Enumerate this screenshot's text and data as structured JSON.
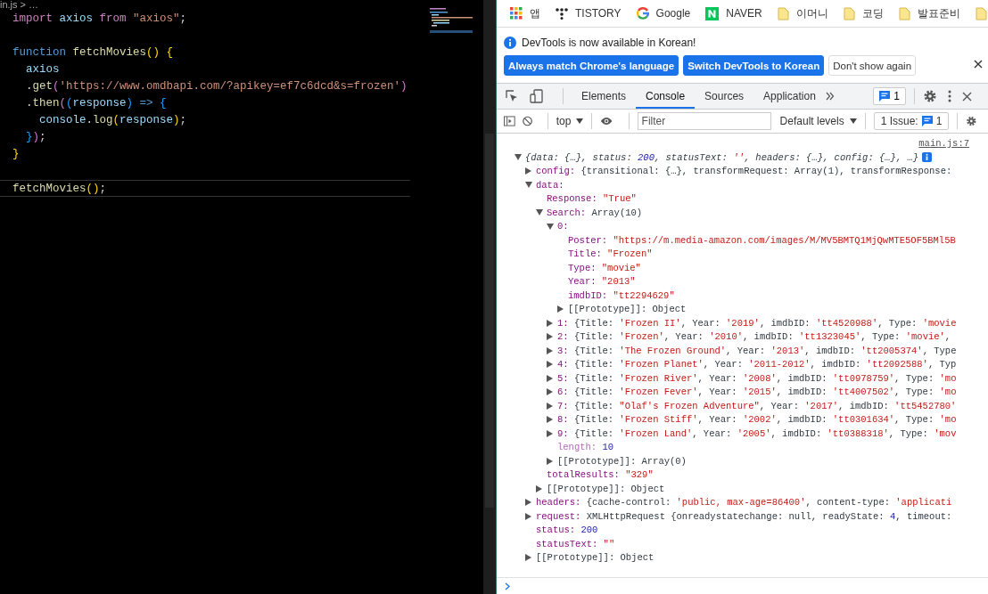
{
  "editor": {
    "breadcrumb": "in.js > …",
    "lines": [
      {
        "current": false,
        "tokens": [
          {
            "kind": "keyword",
            "text": "import"
          },
          {
            "kind": "variable",
            "text": " axios"
          },
          {
            "kind": "keyword",
            "text": " from"
          },
          {
            "kind": "string",
            "text": " \"axios\""
          },
          {
            "kind": "punctuation",
            "text": ";"
          }
        ]
      },
      {
        "current": false
      },
      {
        "current": false,
        "tokens": [
          {
            "kind": "storage",
            "text": "function"
          },
          {
            "kind": "function",
            "text": " fetchMovies"
          },
          {
            "kind": "bracket",
            "text": "()"
          },
          {
            "kind": "bracket",
            "text": " {"
          }
        ]
      },
      {
        "current": false,
        "tokens": [
          {
            "kind": "variable",
            "text": "  axios"
          }
        ]
      },
      {
        "current": false,
        "tokens": [
          {
            "kind": "punctuation",
            "text": "  ."
          },
          {
            "kind": "function",
            "text": "get"
          },
          {
            "kind": "bracket2",
            "text": "("
          },
          {
            "kind": "string",
            "text": "'https://www.omdbapi.com/?apikey=ef7c6dcd&s=frozen'"
          },
          {
            "kind": "bracket2",
            "text": ")"
          }
        ]
      },
      {
        "current": false,
        "tokens": [
          {
            "kind": "punctuation",
            "text": "  ."
          },
          {
            "kind": "function",
            "text": "then"
          },
          {
            "kind": "bracket2",
            "text": "("
          },
          {
            "kind": "bracket3",
            "text": "("
          },
          {
            "kind": "variable",
            "text": "response"
          },
          {
            "kind": "bracket3",
            "text": ")"
          },
          {
            "kind": "storage",
            "text": " =>"
          },
          {
            "kind": "bracket3",
            "text": " {"
          }
        ]
      },
      {
        "current": false,
        "tokens": [
          {
            "kind": "variable",
            "text": "    console"
          },
          {
            "kind": "punctuation",
            "text": "."
          },
          {
            "kind": "function",
            "text": "log"
          },
          {
            "kind": "bracket",
            "text": "("
          },
          {
            "kind": "variable",
            "text": "response"
          },
          {
            "kind": "bracket",
            "text": ")"
          },
          {
            "kind": "punctuation",
            "text": ";"
          }
        ]
      },
      {
        "current": false,
        "tokens": [
          {
            "kind": "bracket3",
            "text": "  }"
          },
          {
            "kind": "bracket2",
            "text": ")"
          },
          {
            "kind": "punctuation",
            "text": ";"
          }
        ]
      },
      {
        "current": false,
        "tokens": [
          {
            "kind": "bracket",
            "text": "}"
          }
        ]
      },
      {
        "current": false
      },
      {
        "current": true,
        "tokens": [
          {
            "kind": "function",
            "text": "fetchMovies"
          },
          {
            "kind": "bracket",
            "text": "()"
          },
          {
            "kind": "punctuation",
            "text": ";"
          }
        ]
      }
    ]
  },
  "bookmarks": [
    {
      "kind": "apps",
      "label": "앱"
    },
    {
      "kind": "dots",
      "label": "TISTORY"
    },
    {
      "kind": "ring",
      "label": "Google"
    },
    {
      "kind": "tile",
      "label": "NAVER"
    },
    {
      "kind": "folder",
      "label": "이머니"
    },
    {
      "kind": "folder",
      "label": "코딩"
    },
    {
      "kind": "folder",
      "label": "발표준비"
    },
    {
      "kind": "folder"
    }
  ],
  "infobar": {
    "message": "DevTools is now available in Korean!",
    "buttons": [
      {
        "label": "Always match Chrome's language",
        "kind": "primary"
      },
      {
        "label": "Switch DevTools to Korean",
        "kind": "primary"
      },
      {
        "label": "Don't show again",
        "kind": "secondary"
      }
    ]
  },
  "tabs": [
    {
      "label": "Elements",
      "selected": false
    },
    {
      "label": "Console",
      "selected": true
    },
    {
      "label": "Sources",
      "selected": false
    },
    {
      "label": "Application",
      "selected": false
    }
  ],
  "issues_badge": "1",
  "console_toolbar": {
    "context": "top",
    "filter_placeholder": "Filter",
    "levels": "Default levels",
    "issues_label": "1 Issue:",
    "issues_count": "1"
  },
  "console": {
    "source_link": "main.js:7",
    "rows": [
      {
        "kind": "summary",
        "expanded": true,
        "value": [
          {
            "kind": "plain",
            "text": "{data: {…}, status: "
          },
          {
            "kind": "number",
            "text": "200"
          },
          {
            "kind": "plain",
            "text": ", statusText: "
          },
          {
            "kind": "string",
            "text": "''"
          },
          {
            "kind": "plain",
            "text": ", headers: {…}, config: {…}, …}"
          }
        ],
        "children": [
          {
            "key": "config:",
            "kind": "property",
            "expanded": false,
            "value": [
              {
                "kind": "plain",
                "text": "{transitional: {…}, transformRequest: Array(1), transformResponse:"
              }
            ]
          },
          {
            "key": "data:",
            "kind": "property",
            "expanded": true,
            "children": [
              {
                "key": "Response:",
                "kind": "property",
                "value": [
                  {
                    "kind": "string",
                    "text": "\"True\""
                  }
                ]
              },
              {
                "key": "Search:",
                "kind": "property",
                "expanded": true,
                "value": [
                  {
                    "kind": "plain",
                    "text": "Array(10)"
                  }
                ],
                "children": [
                  {
                    "key": "0:",
                    "kind": "property",
                    "expanded": true,
                    "children": [
                      {
                        "key": "Poster:",
                        "kind": "property",
                        "value": [
                          {
                            "kind": "string",
                            "text": "\"https://m.media-amazon.com/images/M/MV5BMTQ1MjQwMTE5OF5BMl5B"
                          }
                        ]
                      },
                      {
                        "key": "Title:",
                        "kind": "property",
                        "value": [
                          {
                            "kind": "string",
                            "text": "\"Frozen\""
                          }
                        ]
                      },
                      {
                        "key": "Type:",
                        "kind": "property",
                        "value": [
                          {
                            "kind": "string",
                            "text": "\"movie\""
                          }
                        ]
                      },
                      {
                        "key": "Year:",
                        "kind": "property",
                        "value": [
                          {
                            "kind": "string",
                            "text": "\"2013\""
                          }
                        ]
                      },
                      {
                        "key": "imdbID:",
                        "kind": "property",
                        "value": [
                          {
                            "kind": "string",
                            "text": "\"tt2294629\""
                          }
                        ]
                      },
                      {
                        "key": "[[Prototype]]:",
                        "kind": "internal",
                        "expanded": false,
                        "value": [
                          {
                            "kind": "plain",
                            "text": "Object"
                          }
                        ]
                      }
                    ]
                  },
                  {
                    "key": "1:",
                    "kind": "property",
                    "expanded": false,
                    "value": [
                      {
                        "kind": "plain",
                        "text": "{Title: "
                      },
                      {
                        "kind": "string",
                        "text": "'Frozen II'"
                      },
                      {
                        "kind": "plain",
                        "text": ", Year: "
                      },
                      {
                        "kind": "string",
                        "text": "'2019'"
                      },
                      {
                        "kind": "plain",
                        "text": ", imdbID: "
                      },
                      {
                        "kind": "string",
                        "text": "'tt4520988'"
                      },
                      {
                        "kind": "plain",
                        "text": ", Type: "
                      },
                      {
                        "kind": "string",
                        "text": "'movie"
                      }
                    ]
                  },
                  {
                    "key": "2:",
                    "kind": "property",
                    "expanded": false,
                    "value": [
                      {
                        "kind": "plain",
                        "text": "{Title: "
                      },
                      {
                        "kind": "string",
                        "text": "'Frozen'"
                      },
                      {
                        "kind": "plain",
                        "text": ", Year: "
                      },
                      {
                        "kind": "string",
                        "text": "'2010'"
                      },
                      {
                        "kind": "plain",
                        "text": ", imdbID: "
                      },
                      {
                        "kind": "string",
                        "text": "'tt1323045'"
                      },
                      {
                        "kind": "plain",
                        "text": ", Type: "
                      },
                      {
                        "kind": "string",
                        "text": "'movie'"
                      },
                      {
                        "kind": "plain",
                        "text": ","
                      }
                    ]
                  },
                  {
                    "key": "3:",
                    "kind": "property",
                    "expanded": false,
                    "value": [
                      {
                        "kind": "plain",
                        "text": "{Title: "
                      },
                      {
                        "kind": "string",
                        "text": "'The Frozen Ground'"
                      },
                      {
                        "kind": "plain",
                        "text": ", Year: "
                      },
                      {
                        "kind": "string",
                        "text": "'2013'"
                      },
                      {
                        "kind": "plain",
                        "text": ", imdbID: "
                      },
                      {
                        "kind": "string",
                        "text": "'tt2005374'"
                      },
                      {
                        "kind": "plain",
                        "text": ", Type"
                      }
                    ]
                  },
                  {
                    "key": "4:",
                    "kind": "property",
                    "expanded": false,
                    "value": [
                      {
                        "kind": "plain",
                        "text": "{Title: "
                      },
                      {
                        "kind": "string",
                        "text": "'Frozen Planet'"
                      },
                      {
                        "kind": "plain",
                        "text": ", Year: "
                      },
                      {
                        "kind": "string",
                        "text": "'2011-2012'"
                      },
                      {
                        "kind": "plain",
                        "text": ", imdbID: "
                      },
                      {
                        "kind": "string",
                        "text": "'tt2092588'"
                      },
                      {
                        "kind": "plain",
                        "text": ", Typ"
                      }
                    ]
                  },
                  {
                    "key": "5:",
                    "kind": "property",
                    "expanded": false,
                    "value": [
                      {
                        "kind": "plain",
                        "text": "{Title: "
                      },
                      {
                        "kind": "string",
                        "text": "'Frozen River'"
                      },
                      {
                        "kind": "plain",
                        "text": ", Year: "
                      },
                      {
                        "kind": "string",
                        "text": "'2008'"
                      },
                      {
                        "kind": "plain",
                        "text": ", imdbID: "
                      },
                      {
                        "kind": "string",
                        "text": "'tt0978759'"
                      },
                      {
                        "kind": "plain",
                        "text": ", Type: "
                      },
                      {
                        "kind": "string",
                        "text": "'mo"
                      }
                    ]
                  },
                  {
                    "key": "6:",
                    "kind": "property",
                    "expanded": false,
                    "value": [
                      {
                        "kind": "plain",
                        "text": "{Title: "
                      },
                      {
                        "kind": "string",
                        "text": "'Frozen Fever'"
                      },
                      {
                        "kind": "plain",
                        "text": ", Year: "
                      },
                      {
                        "kind": "string",
                        "text": "'2015'"
                      },
                      {
                        "kind": "plain",
                        "text": ", imdbID: "
                      },
                      {
                        "kind": "string",
                        "text": "'tt4007502'"
                      },
                      {
                        "kind": "plain",
                        "text": ", Type: "
                      },
                      {
                        "kind": "string",
                        "text": "'mo"
                      }
                    ]
                  },
                  {
                    "key": "7:",
                    "kind": "property",
                    "expanded": false,
                    "value": [
                      {
                        "kind": "plain",
                        "text": "{Title: "
                      },
                      {
                        "kind": "string",
                        "text": "\"Olaf's Frozen Adventure\""
                      },
                      {
                        "kind": "plain",
                        "text": ", Year: "
                      },
                      {
                        "kind": "string",
                        "text": "'2017'"
                      },
                      {
                        "kind": "plain",
                        "text": ", imdbID: "
                      },
                      {
                        "kind": "string",
                        "text": "'tt5452780'"
                      }
                    ]
                  },
                  {
                    "key": "8:",
                    "kind": "property",
                    "expanded": false,
                    "value": [
                      {
                        "kind": "plain",
                        "text": "{Title: "
                      },
                      {
                        "kind": "string",
                        "text": "'Frozen Stiff'"
                      },
                      {
                        "kind": "plain",
                        "text": ", Year: "
                      },
                      {
                        "kind": "string",
                        "text": "'2002'"
                      },
                      {
                        "kind": "plain",
                        "text": ", imdbID: "
                      },
                      {
                        "kind": "string",
                        "text": "'tt0301634'"
                      },
                      {
                        "kind": "plain",
                        "text": ", Type: "
                      },
                      {
                        "kind": "string",
                        "text": "'mo"
                      }
                    ]
                  },
                  {
                    "key": "9:",
                    "kind": "property",
                    "expanded": false,
                    "value": [
                      {
                        "kind": "plain",
                        "text": "{Title: "
                      },
                      {
                        "kind": "string",
                        "text": "'Frozen Land'"
                      },
                      {
                        "kind": "plain",
                        "text": ", Year: "
                      },
                      {
                        "kind": "string",
                        "text": "'2005'"
                      },
                      {
                        "kind": "plain",
                        "text": ", imdbID: "
                      },
                      {
                        "kind": "string",
                        "text": "'tt0388318'"
                      },
                      {
                        "kind": "plain",
                        "text": ", Type: "
                      },
                      {
                        "kind": "string",
                        "text": "'mov"
                      }
                    ]
                  },
                  {
                    "key": "length:",
                    "kind": "faded",
                    "value": [
                      {
                        "kind": "number",
                        "text": "10"
                      }
                    ]
                  },
                  {
                    "key": "[[Prototype]]:",
                    "kind": "internal",
                    "expanded": false,
                    "value": [
                      {
                        "kind": "plain",
                        "text": "Array(0)"
                      }
                    ]
                  }
                ]
              },
              {
                "key": "totalResults:",
                "kind": "property",
                "value": [
                  {
                    "kind": "string",
                    "text": "\"329\""
                  }
                ]
              },
              {
                "key": "[[Prototype]]:",
                "kind": "internal",
                "expanded": false,
                "value": [
                  {
                    "kind": "plain",
                    "text": "Object"
                  }
                ]
              }
            ]
          },
          {
            "key": "headers:",
            "kind": "property",
            "expanded": false,
            "value": [
              {
                "kind": "plain",
                "text": "{cache-control: "
              },
              {
                "kind": "string",
                "text": "'public, max-age=86400'"
              },
              {
                "kind": "plain",
                "text": ", content-type: "
              },
              {
                "kind": "string",
                "text": "'applicati"
              }
            ]
          },
          {
            "key": "request:",
            "kind": "property",
            "expanded": false,
            "value": [
              {
                "kind": "plain",
                "text": "XMLHttpRequest {onreadystatechange: null, readyState: "
              },
              {
                "kind": "number",
                "text": "4"
              },
              {
                "kind": "plain",
                "text": ", timeout:"
              }
            ]
          },
          {
            "key": "status:",
            "kind": "property",
            "value": [
              {
                "kind": "number",
                "text": "200"
              }
            ]
          },
          {
            "key": "statusText:",
            "kind": "property",
            "value": [
              {
                "kind": "string",
                "text": "\"\""
              }
            ]
          },
          {
            "key": "[[Prototype]]:",
            "kind": "internal",
            "expanded": false,
            "value": [
              {
                "kind": "plain",
                "text": "Object"
              }
            ]
          }
        ]
      }
    ]
  }
}
